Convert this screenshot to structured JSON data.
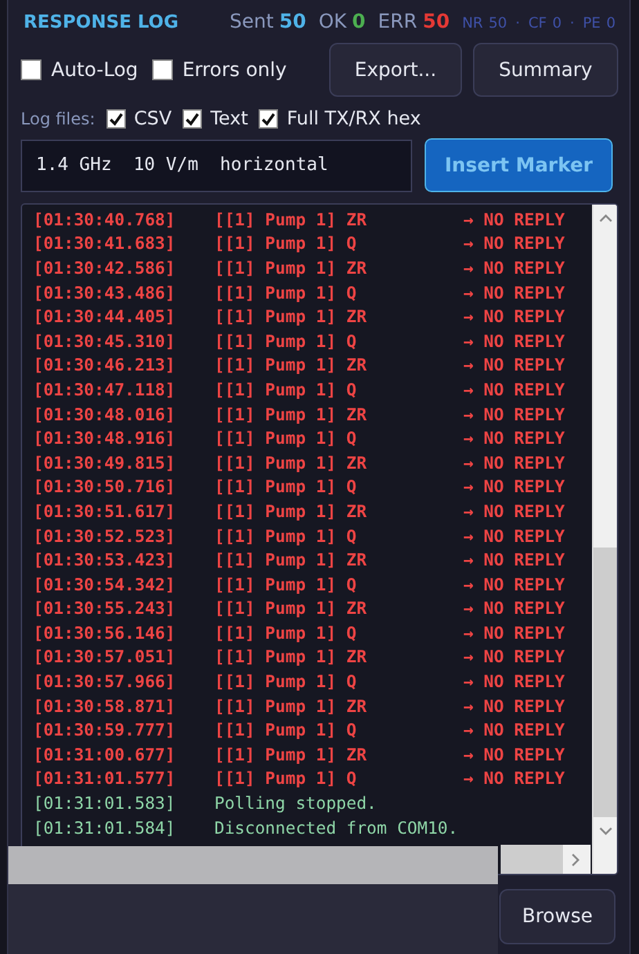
{
  "header": {
    "title": "RESPONSE LOG",
    "stats": [
      {
        "label": "Sent",
        "value": "50",
        "color": "#4fb3e8",
        "kind": "major"
      },
      {
        "label": "OK",
        "value": "0",
        "color": "#4caf50",
        "kind": "major"
      },
      {
        "label": "ERR",
        "value": "50",
        "color": "#e53935",
        "kind": "major"
      },
      {
        "label": "NR",
        "value": "50",
        "color": "#3f51a8",
        "kind": "minor"
      },
      {
        "label": "CF",
        "value": "0",
        "color": "#3f51a8",
        "kind": "minor"
      },
      {
        "label": "PE",
        "value": "0",
        "color": "#3f51a8",
        "kind": "minor"
      }
    ],
    "separator": "·"
  },
  "options": [
    {
      "label": "Auto-Log",
      "checked": false
    },
    {
      "label": "Errors only",
      "checked": false
    }
  ],
  "buttons": [
    "Export...",
    "Summary"
  ],
  "log_files": {
    "label": "Log files:",
    "items": [
      {
        "label": "CSV",
        "checked": true
      },
      {
        "label": "Text",
        "checked": true
      },
      {
        "label": "Full TX/RX hex",
        "checked": true
      }
    ]
  },
  "marker": {
    "value": "1.4 GHz  10 V/m  horizontal",
    "button": "Insert Marker"
  },
  "log": [
    {
      "kind": "error",
      "time": "[01:30:40.768]",
      "message": "[[1] Pump 1] ZR",
      "result": "→ NO REPLY"
    },
    {
      "kind": "error",
      "time": "[01:30:41.683]",
      "message": "[[1] Pump 1] Q",
      "result": "→ NO REPLY"
    },
    {
      "kind": "error",
      "time": "[01:30:42.586]",
      "message": "[[1] Pump 1] ZR",
      "result": "→ NO REPLY"
    },
    {
      "kind": "error",
      "time": "[01:30:43.486]",
      "message": "[[1] Pump 1] Q",
      "result": "→ NO REPLY"
    },
    {
      "kind": "error",
      "time": "[01:30:44.405]",
      "message": "[[1] Pump 1] ZR",
      "result": "→ NO REPLY"
    },
    {
      "kind": "error",
      "time": "[01:30:45.310]",
      "message": "[[1] Pump 1] Q",
      "result": "→ NO REPLY"
    },
    {
      "kind": "error",
      "time": "[01:30:46.213]",
      "message": "[[1] Pump 1] ZR",
      "result": "→ NO REPLY"
    },
    {
      "kind": "error",
      "time": "[01:30:47.118]",
      "message": "[[1] Pump 1] Q",
      "result": "→ NO REPLY"
    },
    {
      "kind": "error",
      "time": "[01:30:48.016]",
      "message": "[[1] Pump 1] ZR",
      "result": "→ NO REPLY"
    },
    {
      "kind": "error",
      "time": "[01:30:48.916]",
      "message": "[[1] Pump 1] Q",
      "result": "→ NO REPLY"
    },
    {
      "kind": "error",
      "time": "[01:30:49.815]",
      "message": "[[1] Pump 1] ZR",
      "result": "→ NO REPLY"
    },
    {
      "kind": "error",
      "time": "[01:30:50.716]",
      "message": "[[1] Pump 1] Q",
      "result": "→ NO REPLY"
    },
    {
      "kind": "error",
      "time": "[01:30:51.617]",
      "message": "[[1] Pump 1] ZR",
      "result": "→ NO REPLY"
    },
    {
      "kind": "error",
      "time": "[01:30:52.523]",
      "message": "[[1] Pump 1] Q",
      "result": "→ NO REPLY"
    },
    {
      "kind": "error",
      "time": "[01:30:53.423]",
      "message": "[[1] Pump 1] ZR",
      "result": "→ NO REPLY"
    },
    {
      "kind": "error",
      "time": "[01:30:54.342]",
      "message": "[[1] Pump 1] Q",
      "result": "→ NO REPLY"
    },
    {
      "kind": "error",
      "time": "[01:30:55.243]",
      "message": "[[1] Pump 1] ZR",
      "result": "→ NO REPLY"
    },
    {
      "kind": "error",
      "time": "[01:30:56.146]",
      "message": "[[1] Pump 1] Q",
      "result": "→ NO REPLY"
    },
    {
      "kind": "error",
      "time": "[01:30:57.051]",
      "message": "[[1] Pump 1] ZR",
      "result": "→ NO REPLY"
    },
    {
      "kind": "error",
      "time": "[01:30:57.966]",
      "message": "[[1] Pump 1] Q",
      "result": "→ NO REPLY"
    },
    {
      "kind": "error",
      "time": "[01:30:58.871]",
      "message": "[[1] Pump 1] ZR",
      "result": "→ NO REPLY"
    },
    {
      "kind": "error",
      "time": "[01:30:59.777]",
      "message": "[[1] Pump 1] Q",
      "result": "→ NO REPLY"
    },
    {
      "kind": "error",
      "time": "[01:31:00.677]",
      "message": "[[1] Pump 1] ZR",
      "result": "→ NO REPLY"
    },
    {
      "kind": "error",
      "time": "[01:31:01.577]",
      "message": "[[1] Pump 1] Q",
      "result": "→ NO REPLY"
    },
    {
      "kind": "info",
      "time": "[01:31:01.583]",
      "message": "Polling stopped."
    },
    {
      "kind": "info",
      "time": "[01:31:01.584]",
      "message": "Disconnected from COM10."
    }
  ],
  "browse_button": "Browse"
}
